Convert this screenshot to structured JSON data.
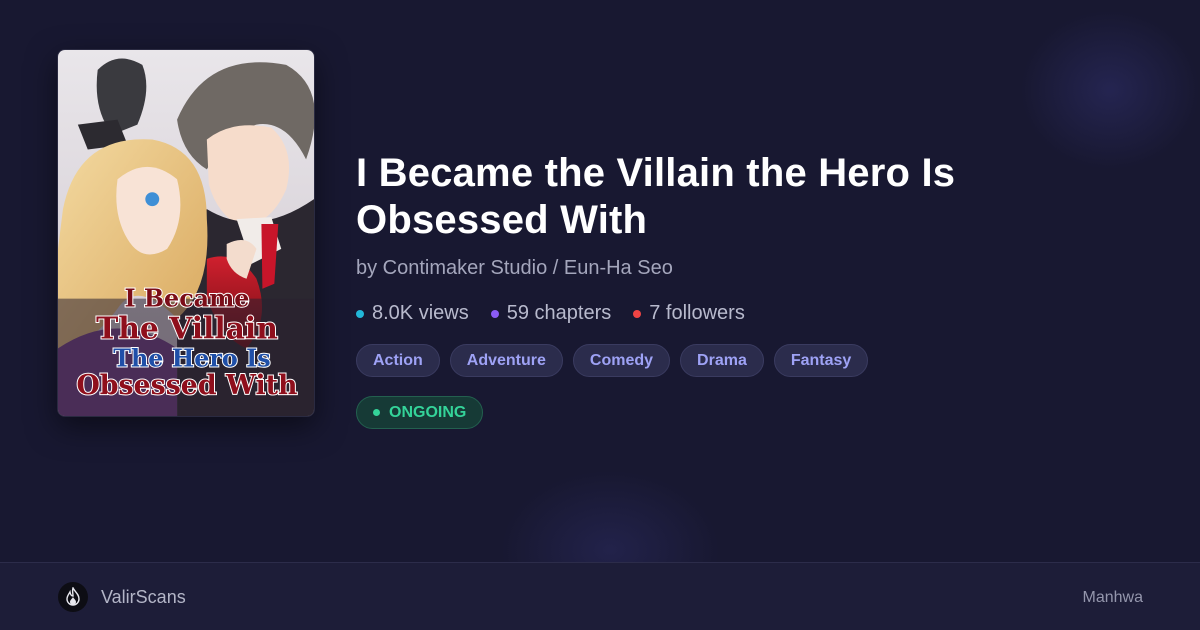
{
  "series": {
    "title": "I Became the Villain the Hero Is Obsessed With",
    "author_line": "by Contimaker Studio / Eun-Ha Seo",
    "cover_title_lines": [
      "I Became",
      "The Villain",
      "The Hero Is",
      "Obsessed With"
    ]
  },
  "stats": [
    {
      "label": "8.0K views",
      "color": "#22b7d8"
    },
    {
      "label": "59 chapters",
      "color": "#8b5cf6"
    },
    {
      "label": "7 followers",
      "color": "#ef4444"
    }
  ],
  "genres": [
    "Action",
    "Adventure",
    "Comedy",
    "Drama",
    "Fantasy"
  ],
  "status": {
    "label": "ONGOING",
    "color": "#34d399"
  },
  "footer": {
    "brand": "ValirScans",
    "type": "Manhwa",
    "logo_icon": "flame-icon"
  },
  "colors": {
    "background": "#181831",
    "tag_text": "#9ea2f5",
    "tag_bg": "#2b2c4c"
  }
}
